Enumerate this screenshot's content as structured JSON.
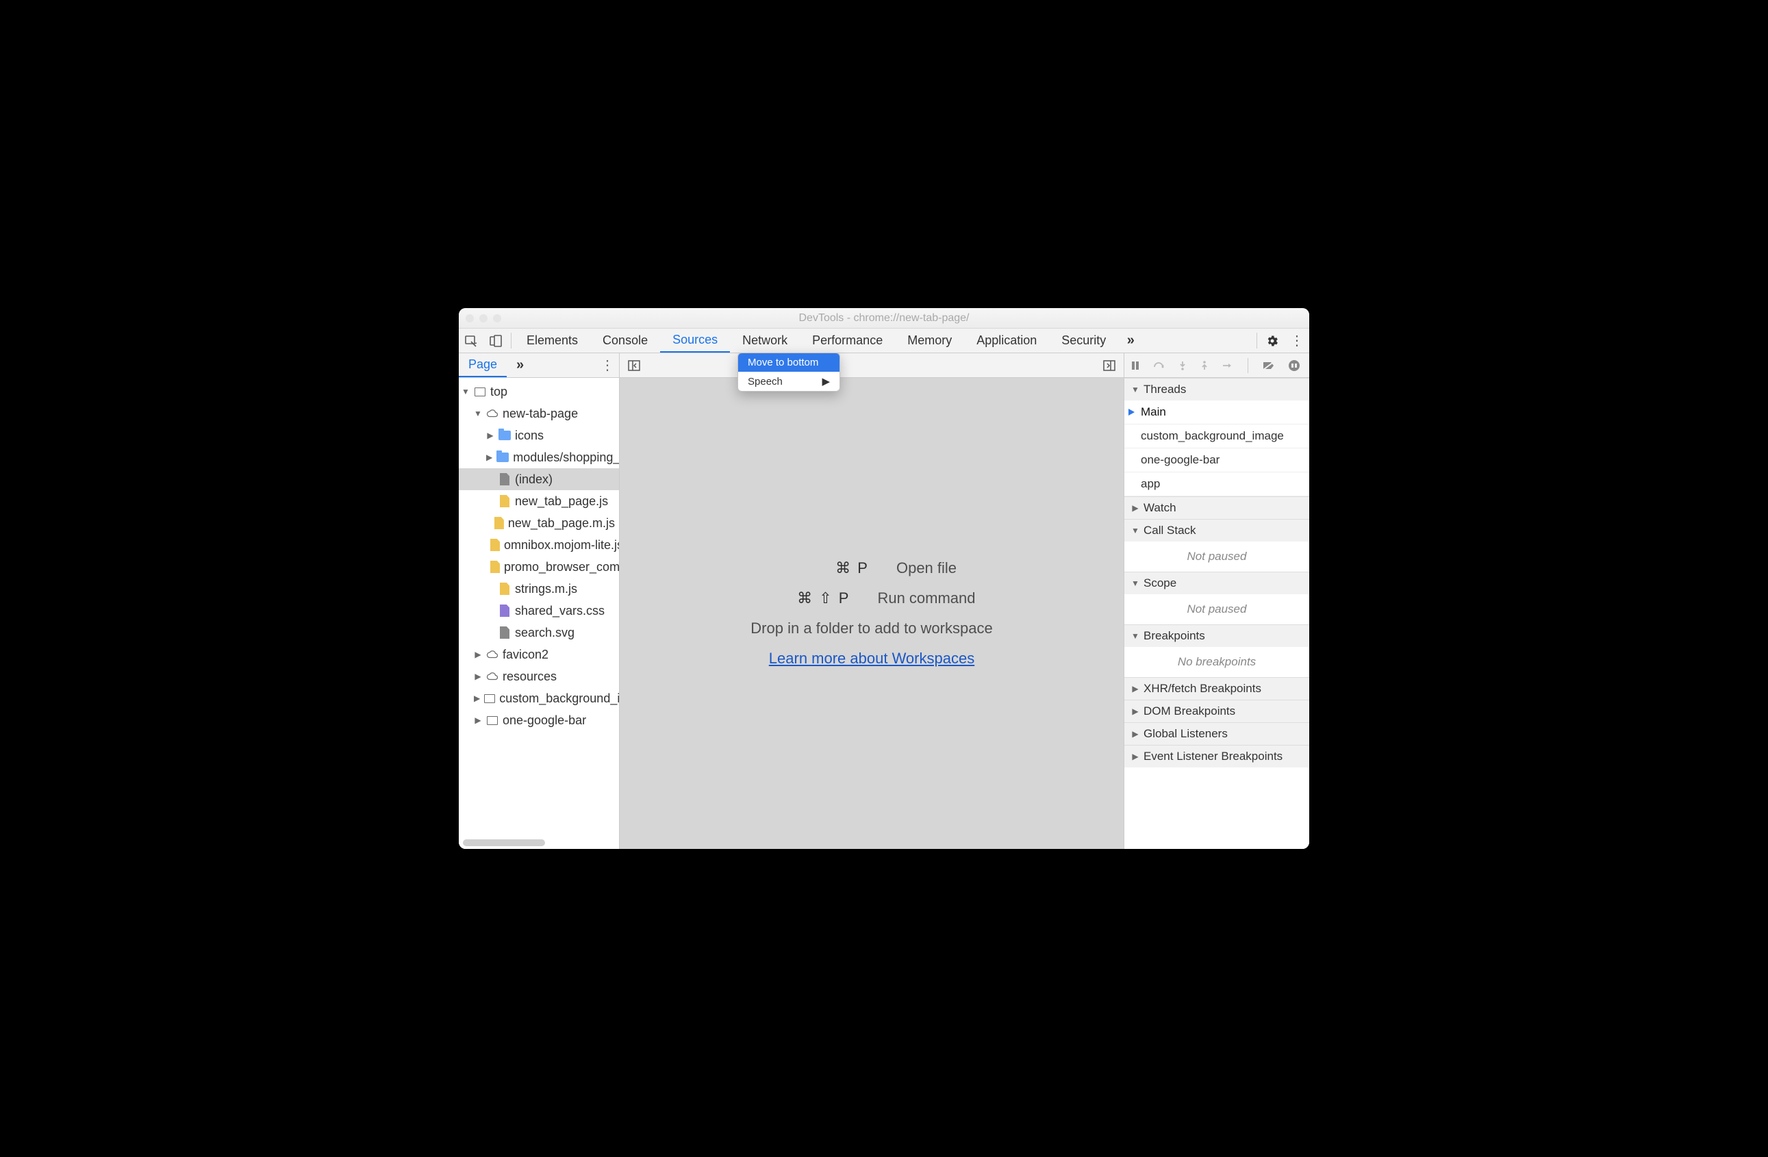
{
  "window": {
    "title": "DevTools - chrome://new-tab-page/"
  },
  "tabs": {
    "items": [
      "Elements",
      "Console",
      "Sources",
      "Network",
      "Performance",
      "Memory",
      "Application",
      "Security"
    ],
    "active": "Sources"
  },
  "sidebar": {
    "tab": "Page",
    "tree": {
      "top": "top",
      "frame": "new-tab-page",
      "folders": {
        "icons": "icons",
        "modules": "modules/shopping_tasks"
      },
      "files": {
        "index": "(index)",
        "ntp_js": "new_tab_page.js",
        "ntp_mjs": "new_tab_page.m.js",
        "omnibox": "omnibox.mojom-lite.js",
        "promo": "promo_browser_command.mojom-lite.js",
        "strings": "strings.m.js",
        "shared": "shared_vars.css",
        "search": "search.svg"
      },
      "more": {
        "favicon": "favicon2",
        "resources": "resources",
        "cbg": "custom_background_image",
        "ogb": "one-google-bar"
      }
    }
  },
  "editor": {
    "open_kbd": "⌘ P",
    "open_label": "Open file",
    "run_kbd": "⌘ ⇧ P",
    "run_label": "Run command",
    "drop": "Drop in a folder to add to workspace",
    "learn": "Learn more about Workspaces"
  },
  "context_menu": {
    "move": "Move to bottom",
    "speech": "Speech"
  },
  "debugger": {
    "sections": {
      "threads": "Threads",
      "watch": "Watch",
      "callstack": "Call Stack",
      "scope": "Scope",
      "breakpoints": "Breakpoints",
      "xhr": "XHR/fetch Breakpoints",
      "dom": "DOM Breakpoints",
      "global": "Global Listeners",
      "event": "Event Listener Breakpoints"
    },
    "threads": [
      "Main",
      "custom_background_image",
      "one-google-bar",
      "app"
    ],
    "not_paused": "Not paused",
    "no_bp": "No breakpoints"
  }
}
